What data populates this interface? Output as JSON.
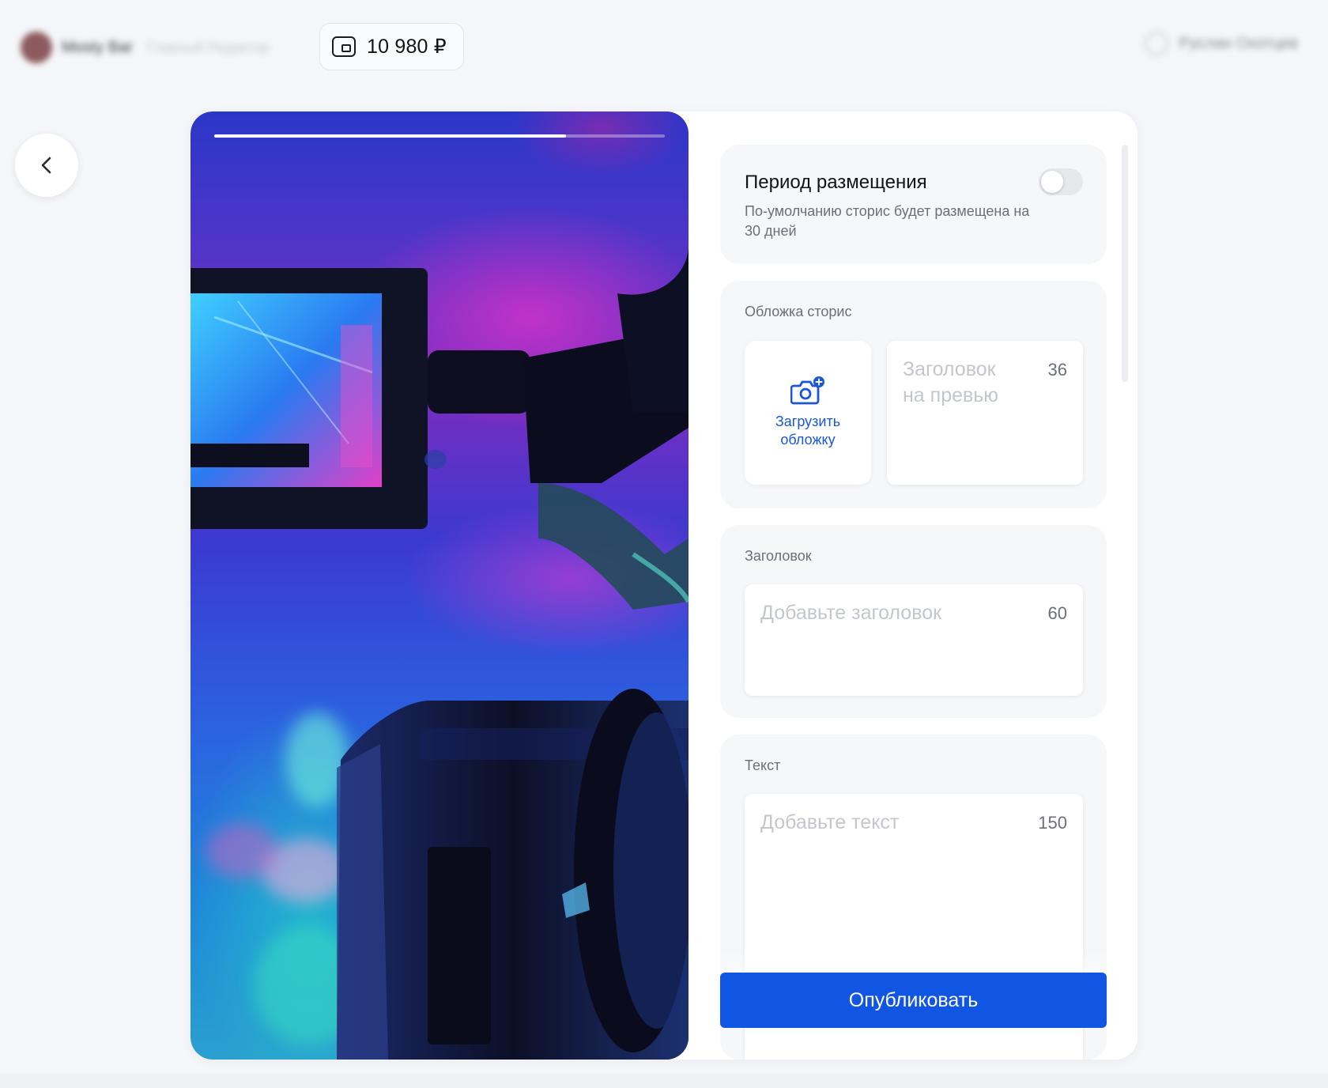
{
  "header": {
    "user_name": "Mosty Bar",
    "user_subtitle": "Главный Редактор",
    "balance": "10 980 ₽",
    "right_label": "Руслан Охотцев"
  },
  "story": {
    "progress": 0.78
  },
  "period": {
    "title": "Период размещения",
    "description": "По-умолчанию сторис будет размещена на 30 дней",
    "enabled": false
  },
  "cover": {
    "label": "Обложка сторис",
    "upload_label": "Загрузить обложку",
    "preview_placeholder": "Заголовок на превью",
    "preview_limit": "36"
  },
  "title_section": {
    "label": "Заголовок",
    "placeholder": "Добавьте заголовок",
    "limit": "60"
  },
  "text_section": {
    "label": "Текст",
    "placeholder": "Добавьте текст",
    "limit": "150"
  },
  "actions": {
    "publish": "Опубликовать"
  },
  "colors": {
    "accent": "#1156e3",
    "link": "#1a56db",
    "background": "#f5f6f9"
  }
}
